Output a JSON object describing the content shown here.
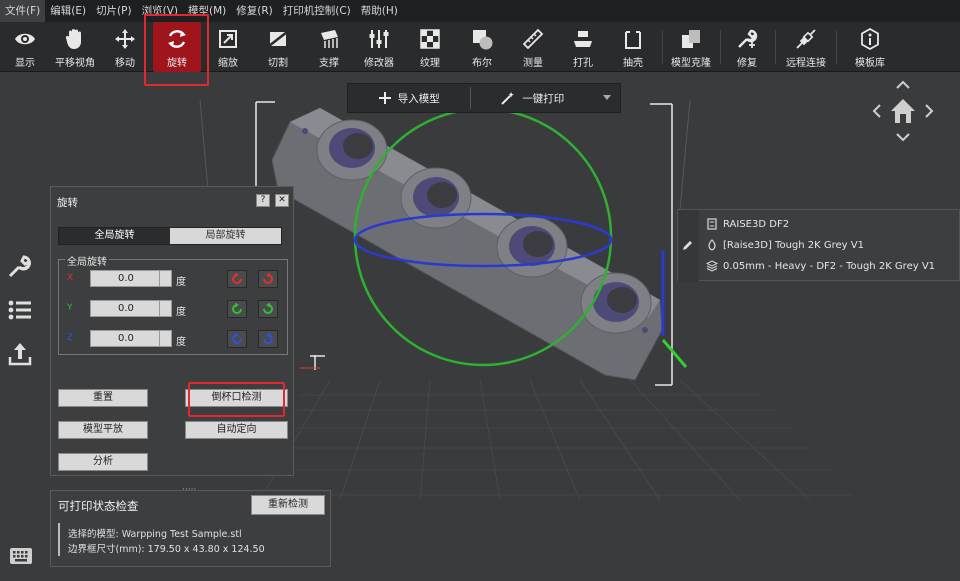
{
  "menu": [
    {
      "label": "文件(F)",
      "active": true
    },
    {
      "label": "编辑(E)"
    },
    {
      "label": "切片(P)"
    },
    {
      "label": "浏览(V)"
    },
    {
      "label": "模型(M)"
    },
    {
      "label": "修复(R)"
    },
    {
      "label": "打印机控制(C)"
    },
    {
      "label": "帮助(H)"
    }
  ],
  "toolbar": {
    "display": "显示",
    "pan": "平移视角",
    "move": "移动",
    "rotate": "旋转",
    "scale": "缩放",
    "cut": "切割",
    "support": "支撑",
    "modifier": "修改器",
    "texture": "纹理",
    "boolean": "布尔",
    "measure": "测量",
    "punch": "打孔",
    "shell": "抽壳",
    "clone": "模型克隆",
    "repair": "修复",
    "remote": "远程连接",
    "library": "模板库"
  },
  "importbar": {
    "import": "导入模型",
    "oneclick": "一键打印"
  },
  "rotate_panel": {
    "title": "旋转",
    "help": "?",
    "close": "✕",
    "tab_global": "全局旋转",
    "tab_local": "局部旋转",
    "group_title": "全局旋转",
    "x_label": "X",
    "y_label": "Y",
    "z_label": "Z",
    "x_value": "0.0",
    "y_value": "0.0",
    "z_value": "0.0",
    "unit": "度",
    "reset": "重置",
    "cup_check": "倒杯口检测",
    "lay_flat": "模型平放",
    "auto_orient": "自动定向",
    "analyze": "分析"
  },
  "check_panel": {
    "title": "可打印状态检查",
    "dots": "·····",
    "recheck": "重新检测",
    "selected_model": "选择的模型: Warpping Test Sample.stl",
    "bbox": "边界框尺寸(mm): 179.50 x 43.80 x 124.50"
  },
  "printer": {
    "name": "RAISE3D DF2",
    "material": "[Raise3D] Tough 2K Grey V1",
    "profile": "0.05mm - Heavy - DF2 - Tough 2K Grey V1"
  },
  "colors": {
    "accent": "#a0141c",
    "highlight": "#e0282e",
    "axis_x": "#e03030",
    "axis_y": "#30c030",
    "axis_z": "#3050e0"
  }
}
